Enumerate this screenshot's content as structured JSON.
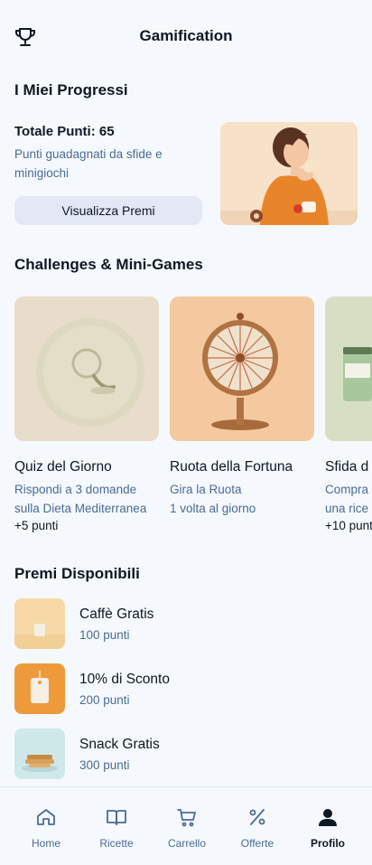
{
  "header": {
    "title": "Gamification",
    "icon": "trophy-icon"
  },
  "progress": {
    "section_title": "I Miei Progressi",
    "total_label": "Totale Punti: 65",
    "description": "Punti guadagnati da sfide e minigiochi",
    "button_label": "Visualizza Premi"
  },
  "challenges": {
    "section_title": "Challenges & Mini-Games",
    "items": [
      {
        "title": "Quiz del Giorno",
        "line1": "Rispondi a 3 domande",
        "line2": "sulla Dieta Mediterranea",
        "points": "+5 punti"
      },
      {
        "title": "Ruota della Fortuna",
        "line1": "Gira la Ruota",
        "line2": "1 volta al giorno",
        "points": ""
      },
      {
        "title": "Sfida d",
        "line1": "Compra",
        "line2": "una rice",
        "points": "+10 punt"
      }
    ]
  },
  "rewards": {
    "section_title": "Premi Disponibili",
    "items": [
      {
        "title": "Caffè Gratis",
        "points": "100 punti"
      },
      {
        "title": "10% di Sconto",
        "points": "200 punti"
      },
      {
        "title": "Snack Gratis",
        "points": "300 punti"
      }
    ]
  },
  "nav": {
    "items": [
      {
        "label": "Home",
        "icon": "home-icon"
      },
      {
        "label": "Ricette",
        "icon": "book-icon"
      },
      {
        "label": "Carrello",
        "icon": "cart-icon"
      },
      {
        "label": "Offerte",
        "icon": "percent-icon"
      },
      {
        "label": "Profilo",
        "icon": "user-icon"
      }
    ],
    "active": "Profilo"
  },
  "colors": {
    "background": "#f5f9fd",
    "accent_text": "#4a6a96",
    "button_bg": "#e3e8f4",
    "primary_text": "#0f1724"
  }
}
